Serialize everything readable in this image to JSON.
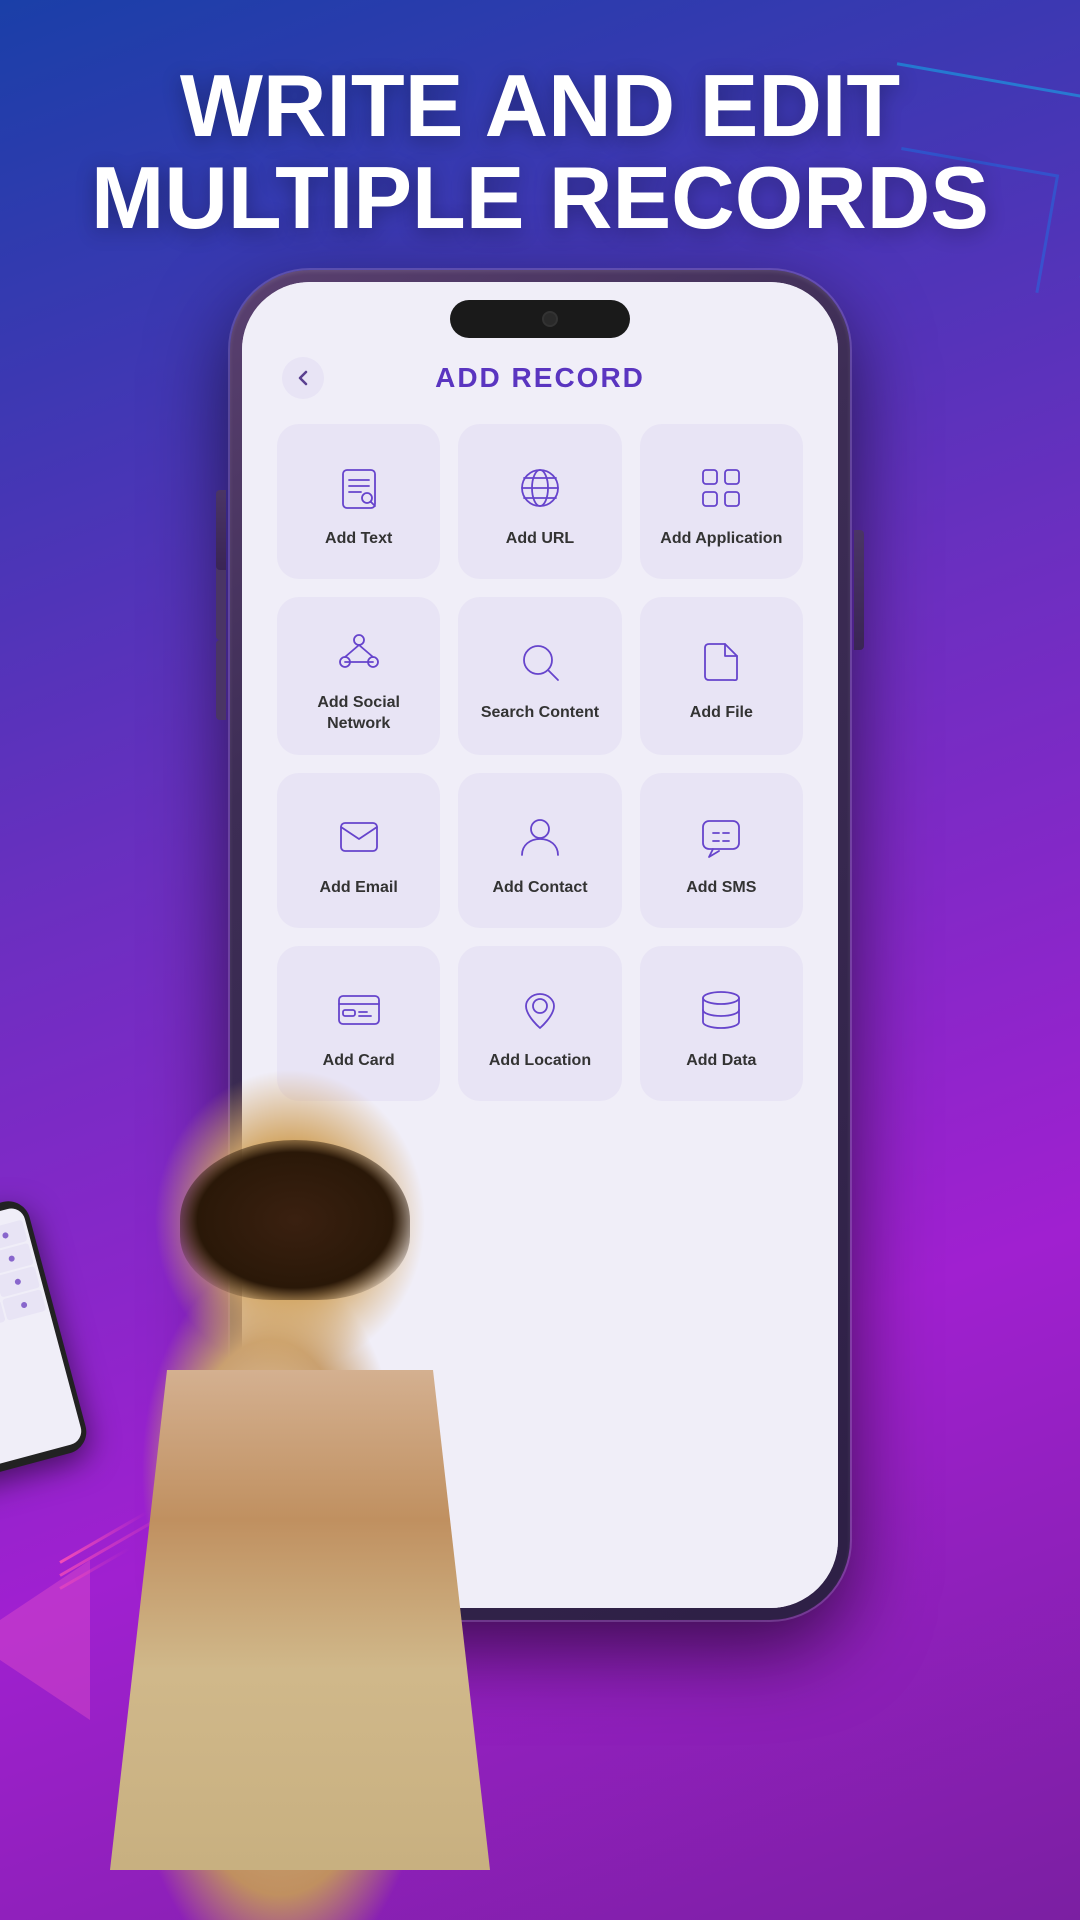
{
  "headline": {
    "line1": "WRITE AND EDIT",
    "line2": "MULTIPLE RECORDS"
  },
  "app": {
    "title": "ADD RECORD",
    "back_label": "←",
    "records": [
      {
        "id": "add-text",
        "label": "Add Text",
        "icon": "text"
      },
      {
        "id": "add-url",
        "label": "Add URL",
        "icon": "url"
      },
      {
        "id": "add-application",
        "label": "Add Application",
        "icon": "app"
      },
      {
        "id": "add-social-network",
        "label": "Add Social Network",
        "icon": "social"
      },
      {
        "id": "search-content",
        "label": "Search Content",
        "icon": "search"
      },
      {
        "id": "add-file",
        "label": "Add File",
        "icon": "file"
      },
      {
        "id": "add-email",
        "label": "Add Email",
        "icon": "email"
      },
      {
        "id": "add-contact",
        "label": "Add Contact",
        "icon": "contact"
      },
      {
        "id": "add-sms",
        "label": "Add SMS",
        "icon": "sms"
      },
      {
        "id": "add-card",
        "label": "Add Card",
        "icon": "card"
      },
      {
        "id": "add-location",
        "label": "Add Location",
        "icon": "location"
      },
      {
        "id": "add-data",
        "label": "Add Data",
        "icon": "data"
      }
    ]
  },
  "colors": {
    "accent": "#6644cc",
    "bg_card": "#e8e4f5",
    "title_color": "#5a35c0"
  }
}
